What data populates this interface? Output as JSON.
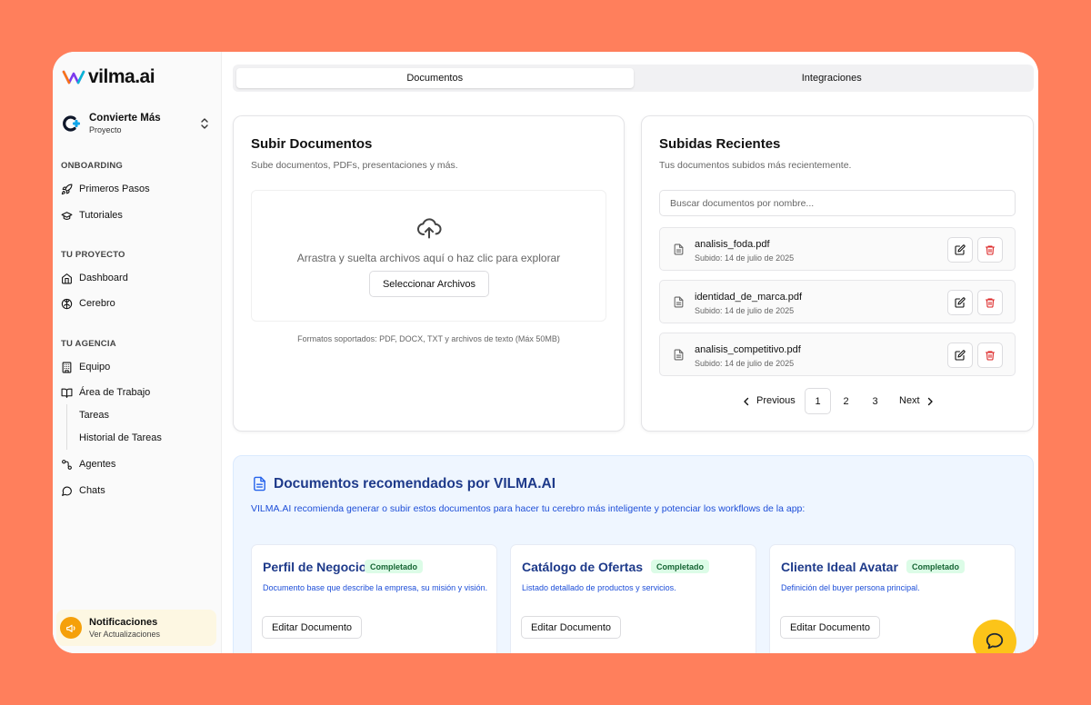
{
  "brand": {
    "name": "vilma.ai"
  },
  "project": {
    "name": "Convierte Más",
    "type": "Proyecto"
  },
  "sidebar": {
    "sections": [
      {
        "title": "ONBOARDING",
        "items": [
          {
            "label": "Primeros Pasos",
            "icon": "rocket-icon"
          },
          {
            "label": "Tutoriales",
            "icon": "graduation-cap-icon"
          }
        ]
      },
      {
        "title": "TU PROYECTO",
        "items": [
          {
            "label": "Dashboard",
            "icon": "home-icon"
          },
          {
            "label": "Cerebro",
            "icon": "brain-icon"
          }
        ]
      },
      {
        "title": "TU AGENCIA",
        "items": [
          {
            "label": "Equipo",
            "icon": "building-icon"
          },
          {
            "label": "Área de Trabajo",
            "icon": "book-open-icon"
          },
          {
            "label": "Tareas"
          },
          {
            "label": "Historial de Tareas"
          },
          {
            "label": "Agentes",
            "icon": "workflow-icon"
          },
          {
            "label": "Chats",
            "icon": "message-circle-icon"
          }
        ]
      }
    ],
    "notification": {
      "title": "Notificaciones",
      "subtitle": "Ver Actualizaciones"
    }
  },
  "tabs": [
    {
      "label": "Documentos",
      "active": true
    },
    {
      "label": "Integraciones",
      "active": false
    }
  ],
  "upload": {
    "title": "Subir Documentos",
    "description": "Sube documentos, PDFs, presentaciones y más.",
    "drop_text": "Arrastra y suelta archivos aquí o haz clic para explorar",
    "select_label": "Seleccionar Archivos",
    "formats": "Formatos soportados: PDF, DOCX, TXT y archivos de texto (Máx 50MB)"
  },
  "recent": {
    "title": "Subidas Recientes",
    "description": "Tus documentos subidos más recientemente.",
    "search_placeholder": "Buscar documentos por nombre...",
    "documents": [
      {
        "name": "analisis_foda.pdf",
        "date": "Subido: 14 de julio de 2025"
      },
      {
        "name": "identidad_de_marca.pdf",
        "date": "Subido: 14 de julio de 2025"
      },
      {
        "name": "analisis_competitivo.pdf",
        "date": "Subido: 14 de julio de 2025"
      }
    ],
    "pagination": {
      "previous": "Previous",
      "next": "Next",
      "pages": [
        "1",
        "2",
        "3"
      ],
      "current": "1"
    }
  },
  "recommended": {
    "title": "Documentos recomendados por VILMA.AI",
    "description": "VILMA.AI recomienda generar o subir estos documentos para hacer tu cerebro más inteligente y potenciar los workflows de la app:",
    "cards": [
      {
        "title": "Perfil de Negocio",
        "status": "Completado",
        "description": "Documento base que describe la empresa, su misión y visión.",
        "action": "Editar Documento"
      },
      {
        "title": "Catálogo de Ofertas",
        "status": "Completado",
        "description": "Listado detallado de productos y servicios.",
        "action": "Editar Documento"
      },
      {
        "title": "Cliente Ideal Avatar",
        "status": "Completado",
        "description": "Definición del buyer persona principal.",
        "action": "Editar Documento"
      }
    ]
  },
  "colors": {
    "background": "#ff7f5c",
    "accent_navy": "#1e3a8a",
    "accent_blue": "#1d4ed8",
    "badge_green": "#166534",
    "delete_red": "#dc2626",
    "chat_yellow": "#fcc419"
  }
}
